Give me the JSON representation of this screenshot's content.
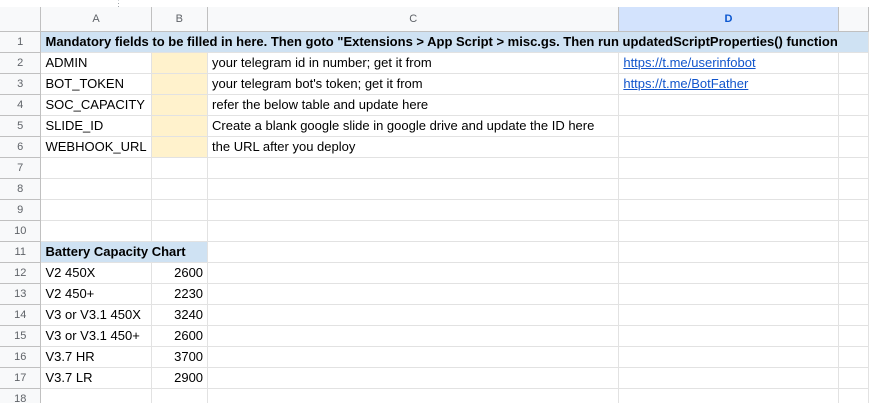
{
  "columns": [
    "A",
    "B",
    "C",
    "D"
  ],
  "selected_column": "D",
  "row_numbers": [
    "1",
    "2",
    "3",
    "4",
    "5",
    "6",
    "7",
    "8",
    "9",
    "10",
    "11",
    "12",
    "13",
    "14",
    "15",
    "16",
    "17",
    "18"
  ],
  "banner": "Mandatory fields to be filled in here. Then goto \"Extensions > App Script > misc.gs. Then run updatedScriptProperties() function",
  "fields": [
    {
      "name": "ADMIN",
      "desc": "your telegram id in number; get it from",
      "link": "https://t.me/userinfobot"
    },
    {
      "name": "BOT_TOKEN",
      "desc": "your telegram bot's token; get it from",
      "link": "https://t.me/BotFather"
    },
    {
      "name": "SOC_CAPACITY",
      "desc": "refer the below table and update here",
      "link": ""
    },
    {
      "name": "SLIDE_ID",
      "desc": "Create a blank google slide in google drive and update the ID here",
      "link": ""
    },
    {
      "name": "WEBHOOK_URL",
      "desc": "the URL after you deploy",
      "link": ""
    }
  ],
  "battery_chart": {
    "title": "Battery Capacity Chart",
    "rows": [
      {
        "model": "V2 450X",
        "capacity": "2600"
      },
      {
        "model": "V2 450+",
        "capacity": "2230"
      },
      {
        "model": "V3 or V3.1 450X",
        "capacity": "3240"
      },
      {
        "model": "V3 or V3.1 450+",
        "capacity": "2600"
      },
      {
        "model": "V3.7 HR",
        "capacity": "3700"
      },
      {
        "model": "V3.7 LR",
        "capacity": "2900"
      }
    ]
  },
  "colors": {
    "banner_bg": "#cfe2f3",
    "input_bg": "#fff2cc",
    "link": "#1155cc",
    "selected_header_bg": "#d3e3fd"
  }
}
